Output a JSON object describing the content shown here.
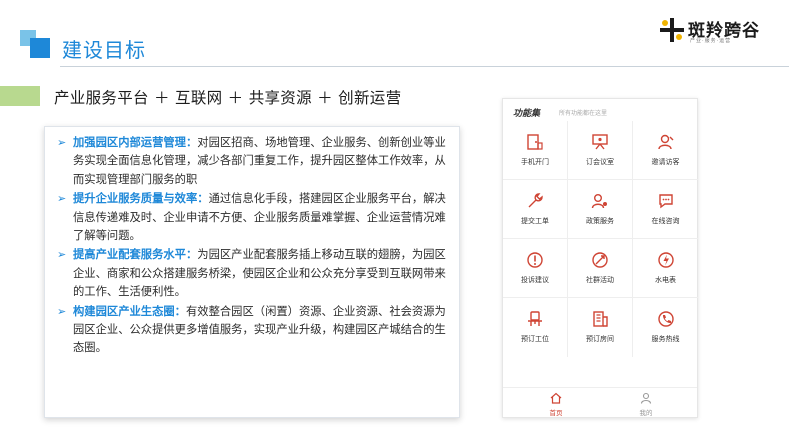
{
  "header": {
    "title": "建设目标",
    "logo_text": "斑羚跨谷",
    "logo_sub": "产业·服务·运营"
  },
  "slogan": "产业服务平台 ＋ 互联网 ＋ 共享资源 ＋ 创新运营",
  "bullets": [
    {
      "lead": "加强园区内部运营管理：",
      "text": "对园区招商、场地管理、企业服务、创新创业等业务实现全面信息化管理，减少各部门重复工作，提升园区整体工作效率，从而实现管理部门服务的职"
    },
    {
      "lead": "提升企业服务质量与效率：",
      "text": "通过信息化手段，搭建园区企业服务平台，解决信息传递难及时、企业申请不方便、企业服务质量难掌握、企业运营情况难了解等问题。"
    },
    {
      "lead": "提高产业配套服务水平：",
      "text": "为园区产业配套服务插上移动互联的翅膀，为园区企业、商家和公众搭建服务桥梁，使园区企业和公众充分享受到互联网带来的工作、生活便利性。"
    },
    {
      "lead": "构建园区产业生态圈：",
      "text": "有效整合园区（闲置）资源、企业资源、社会资源为园区企业、公众提供更多增值服务，实现产业升级，构建园区产城结合的生态圈。"
    }
  ],
  "phone": {
    "header": "功能集",
    "sub": "所有功能都在这里",
    "grid": [
      {
        "label": "手机开门",
        "icon": "door-icon"
      },
      {
        "label": "订会议室",
        "icon": "meeting-room-icon"
      },
      {
        "label": "邀请访客",
        "icon": "visitor-icon"
      },
      {
        "label": "提交工单",
        "icon": "wrench-icon"
      },
      {
        "label": "政策服务",
        "icon": "policy-icon"
      },
      {
        "label": "在线咨询",
        "icon": "chat-icon"
      },
      {
        "label": "投诉建议",
        "icon": "complaint-icon"
      },
      {
        "label": "社群活动",
        "icon": "activity-icon"
      },
      {
        "label": "水电表",
        "icon": "meter-icon"
      },
      {
        "label": "预订工位",
        "icon": "workstation-icon"
      },
      {
        "label": "预订房间",
        "icon": "room-icon"
      },
      {
        "label": "服务热线",
        "icon": "phone-icon"
      }
    ],
    "tabs": [
      {
        "label": "首页",
        "icon": "home-icon",
        "color": "#cf4434"
      },
      {
        "label": "我的",
        "icon": "user-icon",
        "color": "#999999"
      }
    ]
  },
  "colors": {
    "accent": "#1e88d8",
    "icon_red": "#cf4434",
    "tab_green": "#b8d98f"
  }
}
